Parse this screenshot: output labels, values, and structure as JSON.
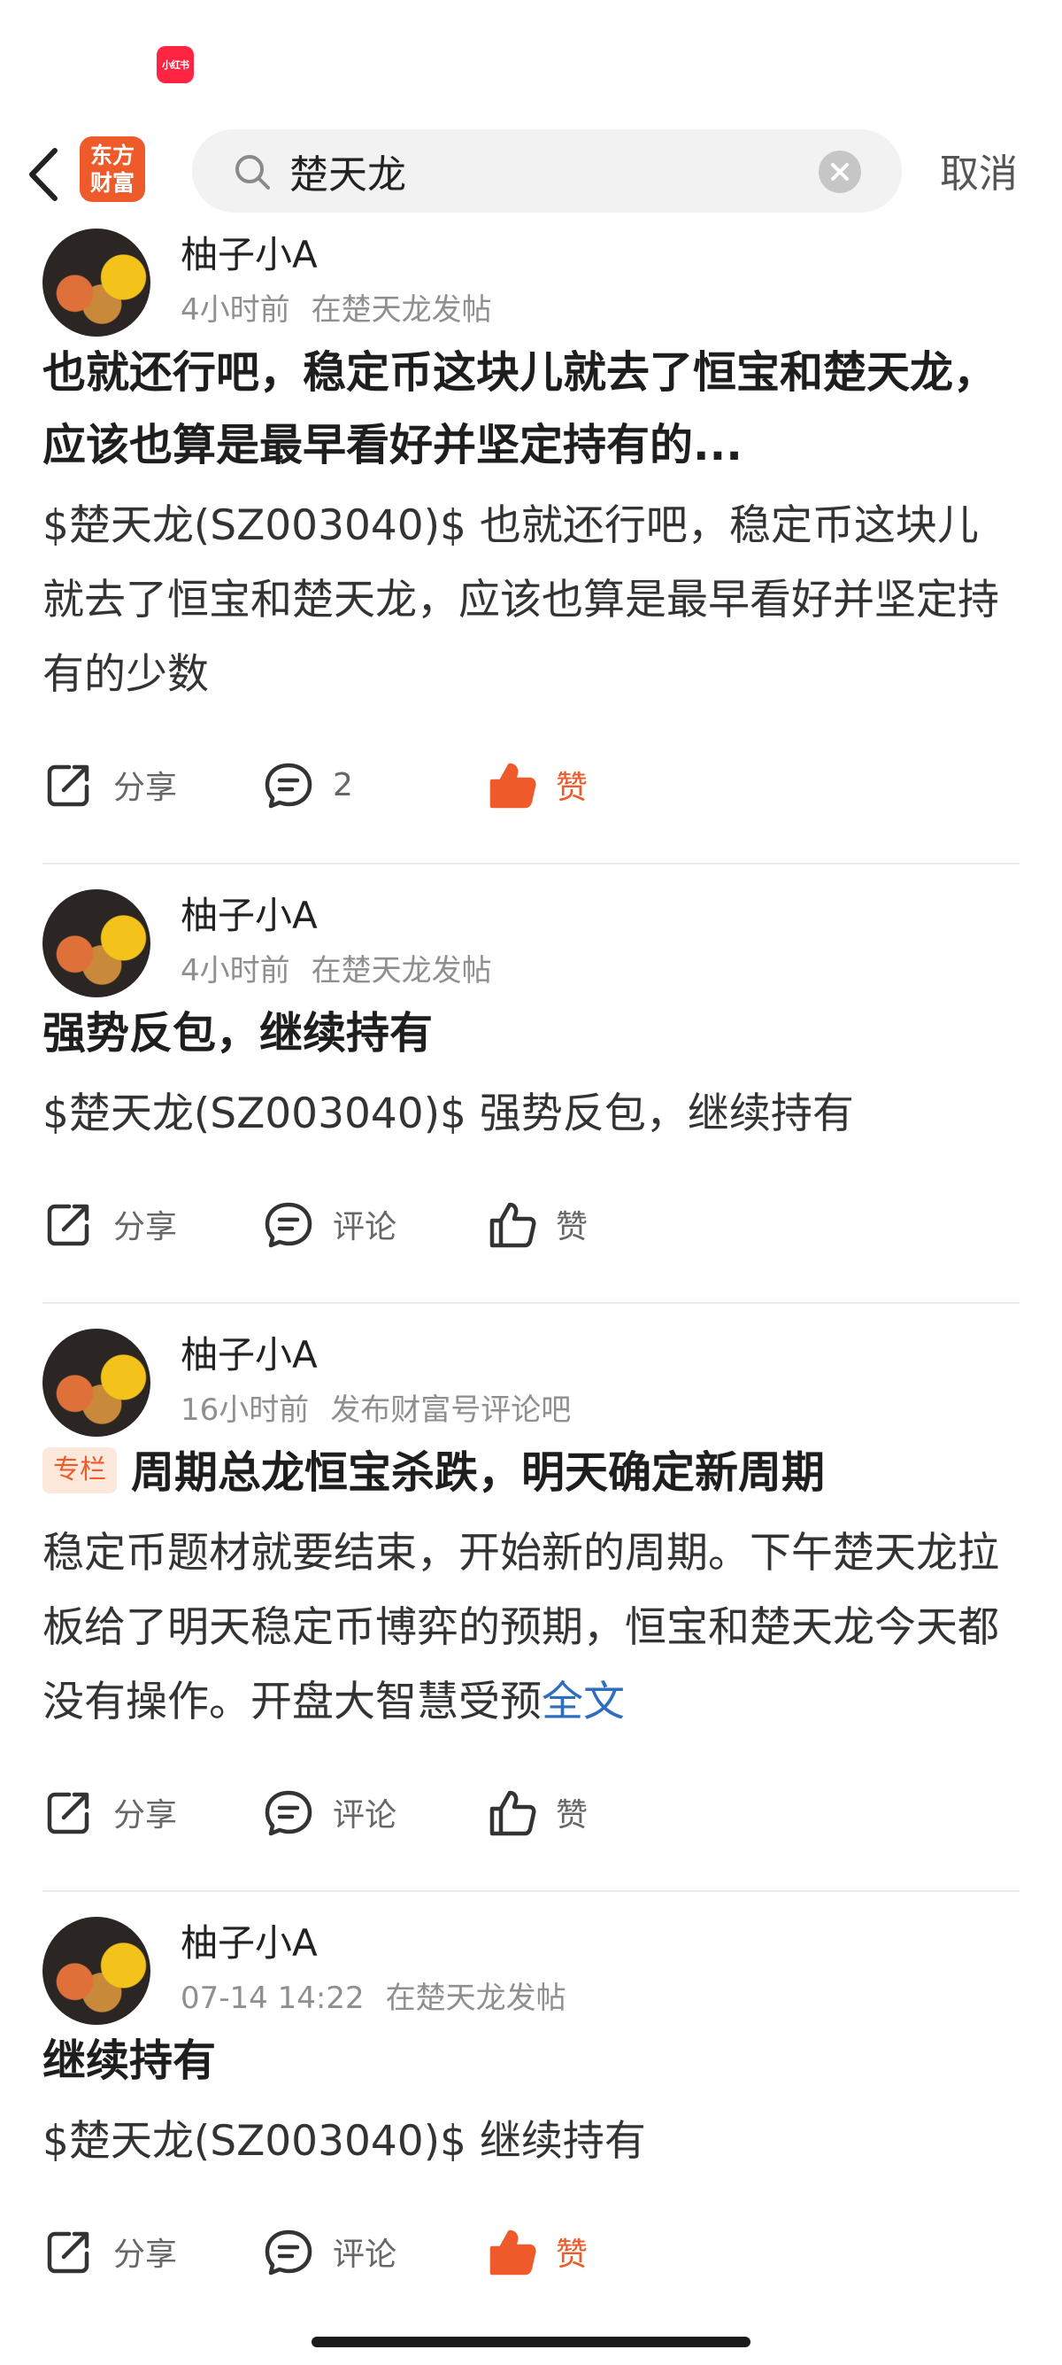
{
  "status_bar": {
    "app_badge_label": "小红书"
  },
  "header": {
    "logo_line1": "东方",
    "logo_line2": "财富",
    "search_value": "楚天龙",
    "cancel_label": "取消"
  },
  "posts": [
    {
      "username": "柚子小A",
      "time": "4小时前",
      "source": "在楚天龙发帖",
      "title": "也就还行吧，稳定币这块儿就去了恒宝和楚天龙，应该也算是最早看好并坚定持有的...",
      "body": "$楚天龙(SZ003040)$ 也就还行吧，稳定币这块儿就去了恒宝和楚天龙，应该也算是最早看好并坚定持有的少数",
      "share_label": "分享",
      "comment_label": "2",
      "like_label": "赞",
      "liked": true
    },
    {
      "username": "柚子小A",
      "time": "4小时前",
      "source": "在楚天龙发帖",
      "title": "强势反包，继续持有",
      "body": "$楚天龙(SZ003040)$ 强势反包，继续持有",
      "share_label": "分享",
      "comment_label": "评论",
      "like_label": "赞",
      "liked": false
    },
    {
      "username": "柚子小A",
      "time": "16小时前",
      "source": "发布财富号评论吧",
      "tag": "专栏",
      "title": "周期总龙恒宝杀跌，明天确定新周期",
      "body": "稳定币题材就要结束，开始新的周期。下午楚天龙拉板给了明天稳定币博弈的预期，恒宝和楚天龙今天都没有操作。开盘大智慧受预",
      "body_more": "全文",
      "share_label": "分享",
      "comment_label": "评论",
      "like_label": "赞",
      "liked": false
    },
    {
      "username": "柚子小A",
      "time": "07-14 14:22",
      "source": "在楚天龙发帖",
      "title": "继续持有",
      "body": "$楚天龙(SZ003040)$ 继续持有",
      "share_label": "分享",
      "comment_label": "评论",
      "like_label": "赞",
      "liked": true
    }
  ],
  "colors": {
    "accent": "#ef5a2a",
    "link": "#2f6dbf",
    "muted": "#8f8f8f"
  }
}
